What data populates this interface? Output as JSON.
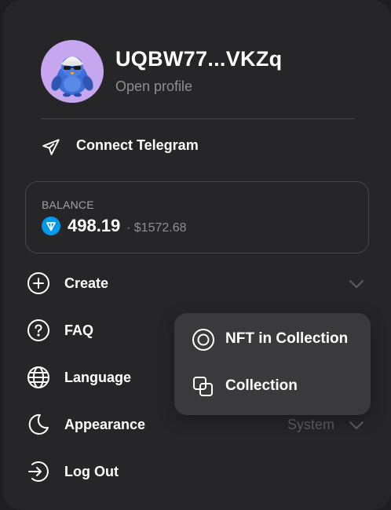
{
  "profile": {
    "username": "UQBW77...VKZq",
    "open_profile_label": "Open profile"
  },
  "telegram": {
    "label": "Connect Telegram",
    "icon": "paper-plane-icon"
  },
  "balance": {
    "label": "BALANCE",
    "amount": "498.19",
    "usd": "· $1572.68",
    "currency_icon": "ton-icon",
    "currency_color": "#0098ea"
  },
  "menu": {
    "create": {
      "label": "Create",
      "icon": "plus-circle-icon"
    },
    "faq": {
      "label": "FAQ",
      "icon": "question-circle-icon"
    },
    "language": {
      "label": "Language",
      "icon": "globe-icon"
    },
    "appearance": {
      "label": "Appearance",
      "icon": "moon-icon",
      "value": "System"
    },
    "logout": {
      "label": "Log Out",
      "icon": "logout-icon"
    }
  },
  "create_popup": {
    "items": [
      {
        "label": "NFT in Collection",
        "icon": "target-icon"
      },
      {
        "label": "Collection",
        "icon": "overlapping-squares-icon"
      }
    ]
  },
  "colors": {
    "panel_bg": "#262628",
    "muted_text": "#8e8e93",
    "avatar_bg": "#c6a6ee",
    "popup_bg": "#3a3a3d"
  }
}
